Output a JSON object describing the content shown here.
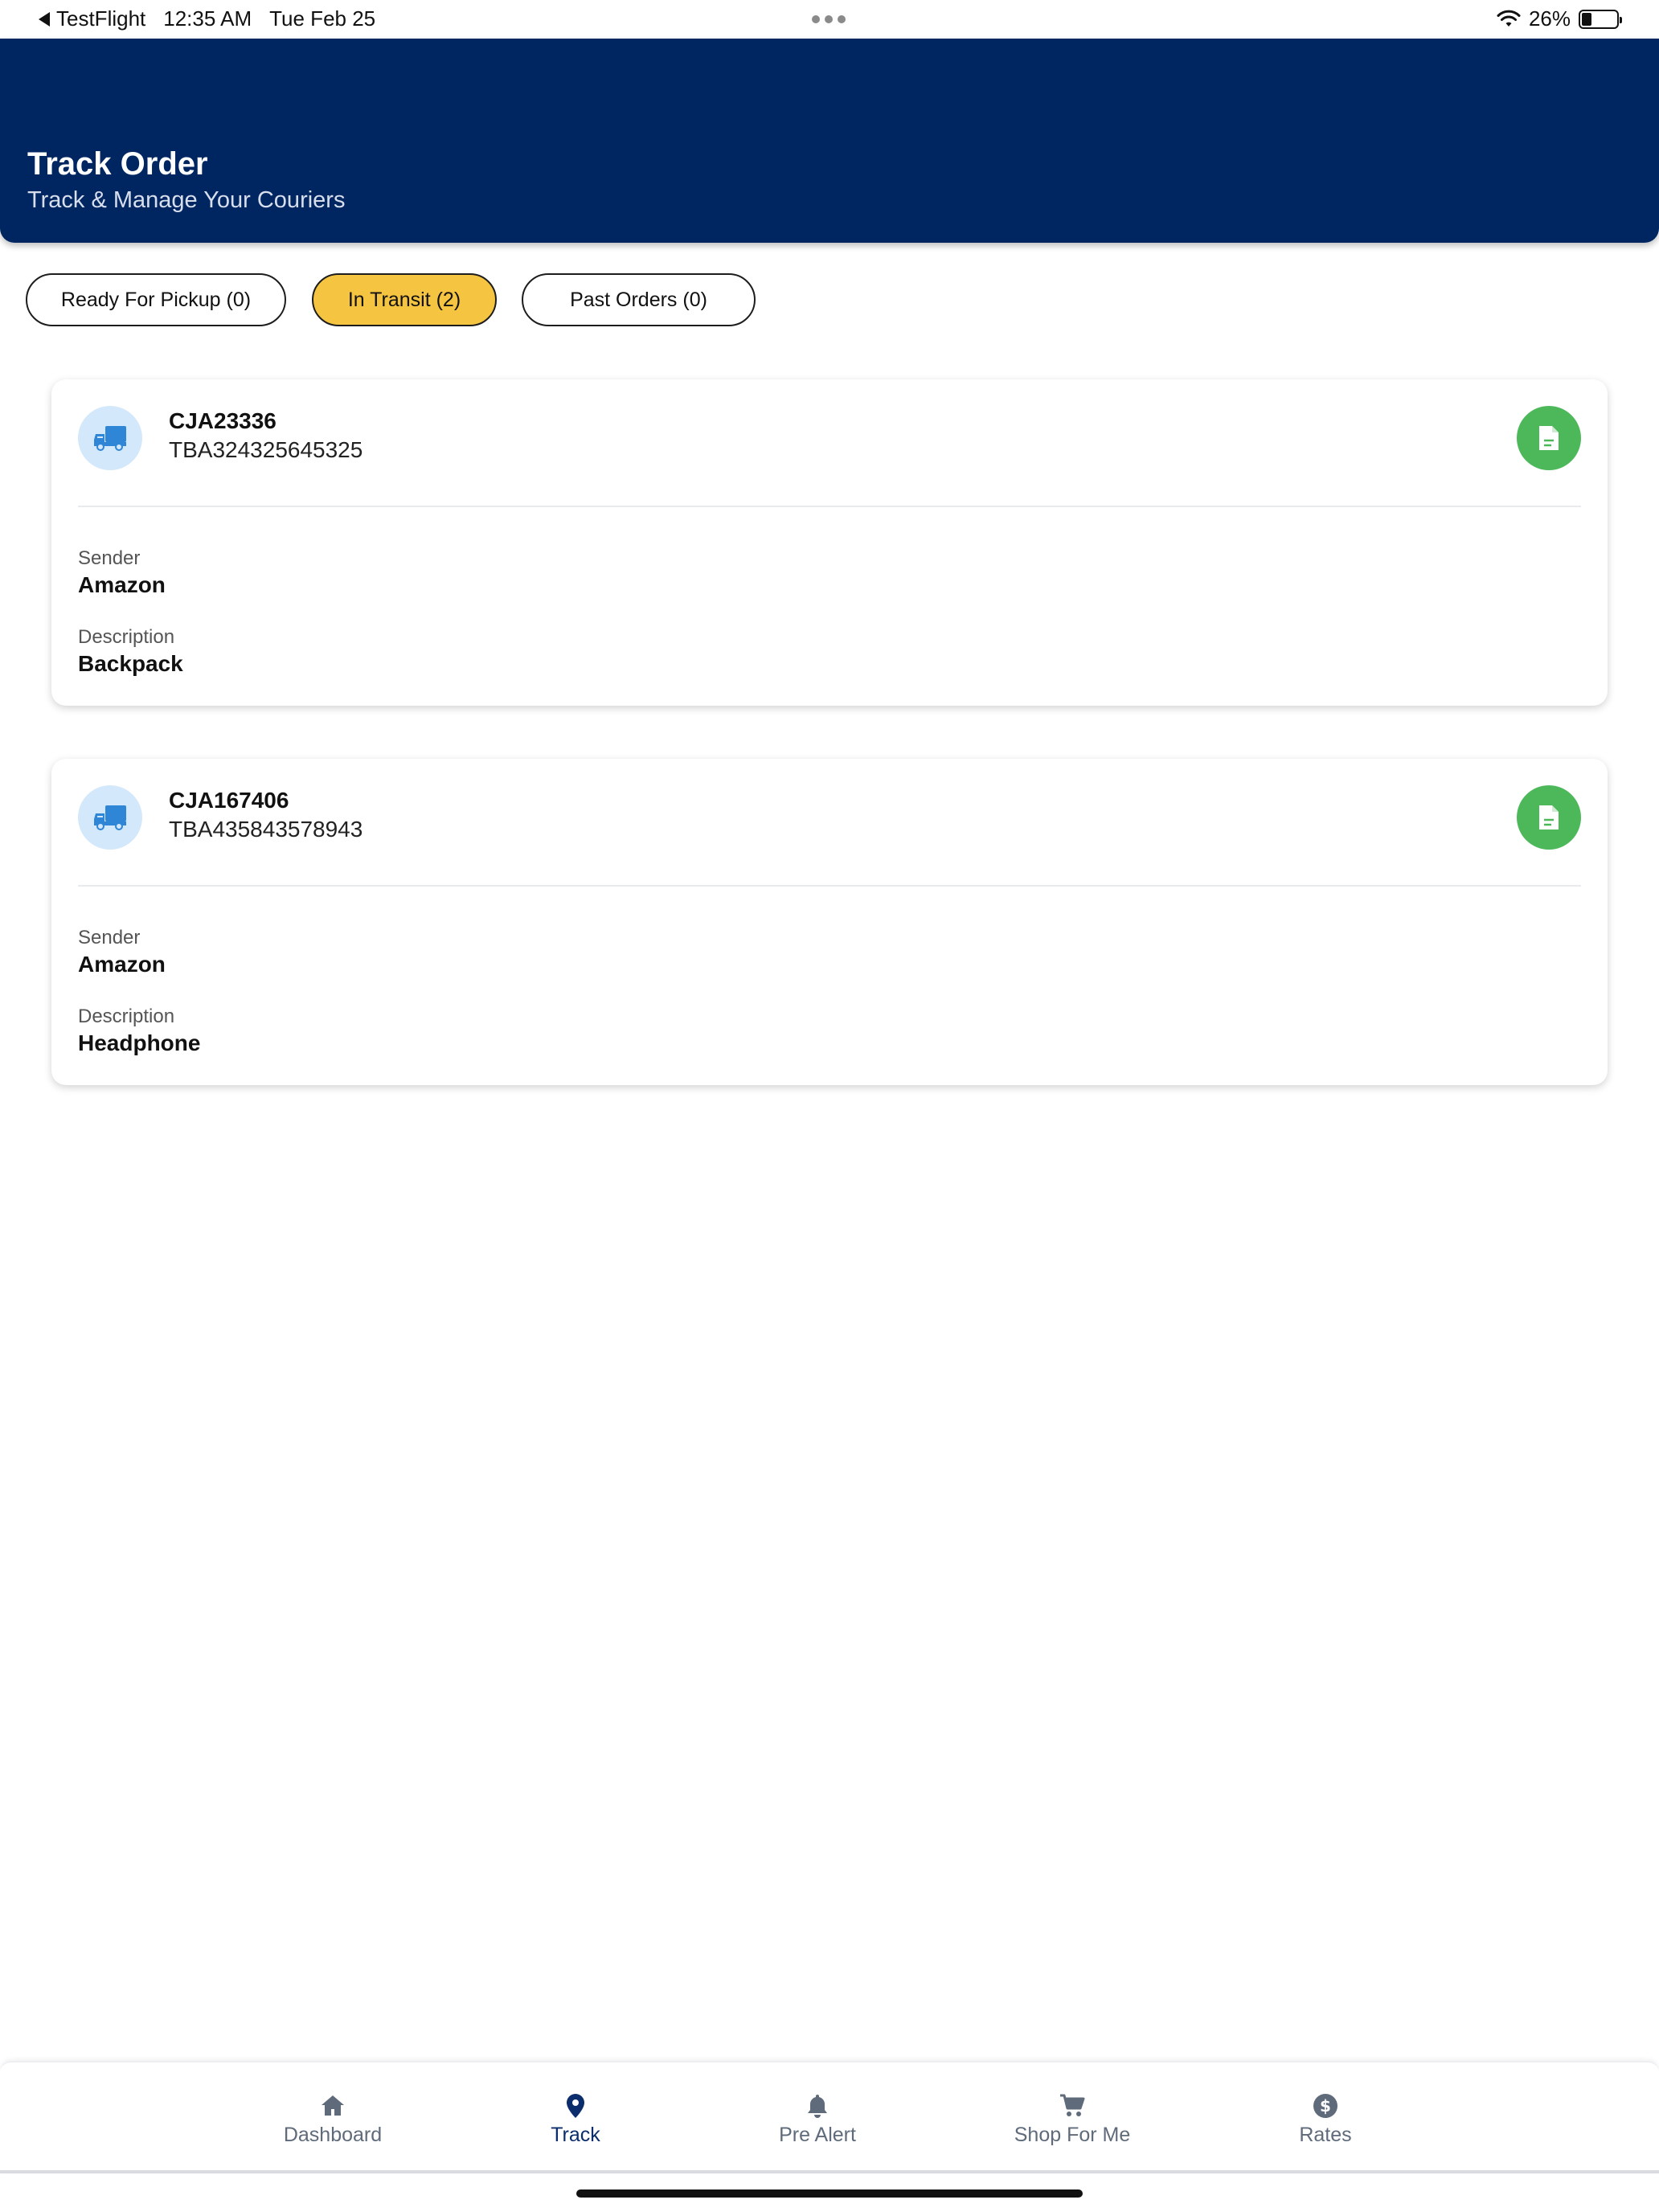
{
  "status_bar": {
    "back_app": "TestFlight",
    "time": "12:35 AM",
    "date": "Tue Feb 25",
    "battery": "26%"
  },
  "header": {
    "title": "Track Order",
    "subtitle": "Track & Manage Your Couriers",
    "background_color": "#002662"
  },
  "filters": [
    {
      "label": "Ready For Pickup (0)",
      "active": false
    },
    {
      "label": "In Transit (2)",
      "active": true
    },
    {
      "label": "Past Orders (0)",
      "active": false
    }
  ],
  "accent_color": "#f5c542",
  "orders": [
    {
      "order_id": "CJA23336",
      "tracking_number": "TBA324325645325",
      "sender_label": "Sender",
      "sender": "Amazon",
      "description_label": "Description",
      "description": "Backpack",
      "icon": "truck-icon",
      "action_icon": "document-icon"
    },
    {
      "order_id": "CJA167406",
      "tracking_number": "TBA435843578943",
      "sender_label": "Sender",
      "sender": "Amazon",
      "description_label": "Description",
      "description": "Headphone",
      "icon": "truck-icon",
      "action_icon": "document-icon"
    }
  ],
  "bottom_nav": [
    {
      "label": "Dashboard",
      "icon": "home-icon",
      "active": false
    },
    {
      "label": "Track",
      "icon": "location-pin-icon",
      "active": true
    },
    {
      "label": "Pre Alert",
      "icon": "bell-icon",
      "active": false
    },
    {
      "label": "Shop For Me",
      "icon": "cart-icon",
      "active": false
    },
    {
      "label": "Rates",
      "icon": "dollar-icon",
      "active": false
    }
  ]
}
